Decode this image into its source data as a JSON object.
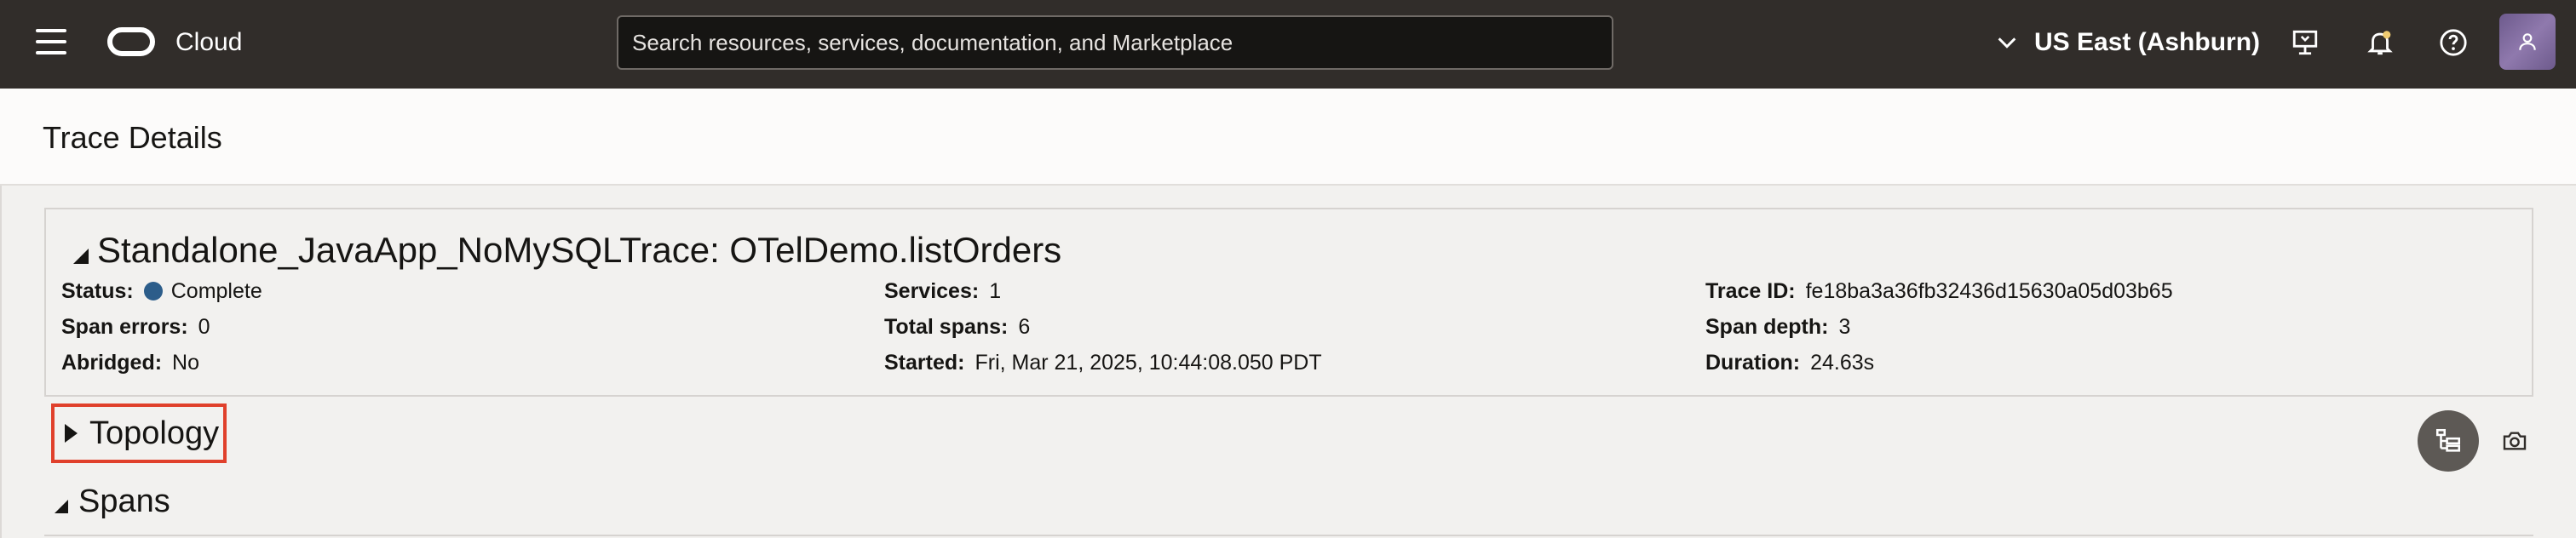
{
  "topbar": {
    "brand": "Cloud",
    "search_placeholder": "Search resources, services, documentation, and Marketplace",
    "region": "US East (Ashburn)",
    "icons": [
      "menu-icon",
      "oracle-logo",
      "chevron-down-icon",
      "developer-tools-icon",
      "bell-icon",
      "help-icon",
      "user-icon"
    ],
    "notification_dot_color": "#f0cc71"
  },
  "page": {
    "title": "Trace Details"
  },
  "trace": {
    "title": "Standalone_JavaApp_NoMySQLTrace: OTelDemo.listOrders",
    "fields": {
      "status_label": "Status:",
      "status_value": "Complete",
      "status_color": "#2c5d8a",
      "span_errors_label": "Span errors:",
      "span_errors_value": "0",
      "abridged_label": "Abridged:",
      "abridged_value": "No",
      "services_label": "Services:",
      "services_value": "1",
      "total_spans_label": "Total spans:",
      "total_spans_value": "6",
      "started_label": "Started:",
      "started_value": "Fri, Mar 21, 2025, 10:44:08.050 PDT",
      "trace_id_label": "Trace ID:",
      "trace_id_value": "fe18ba3a36fb32436d15630a05d03b65",
      "span_depth_label": "Span depth:",
      "span_depth_value": "3",
      "duration_label": "Duration:",
      "duration_value": "24.63s"
    }
  },
  "sections": {
    "topology": "Topology",
    "spans": "Spans"
  },
  "highlight_color": "#e0402b"
}
